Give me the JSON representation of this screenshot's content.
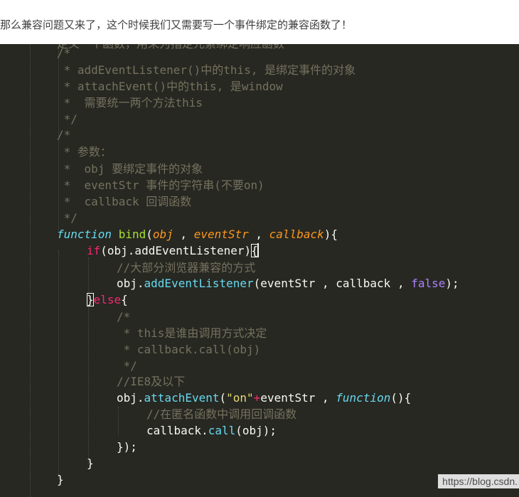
{
  "intro": {
    "text": "那么兼容问题又来了，这个时候我们又需要写一个事件绑定的兼容函数了！"
  },
  "code": {
    "cut_top": "定义一个函数，用来为指定元素绑定响应函数",
    "c1": {
      "open": "/*",
      "l1": " * addEventListener()中的this, 是绑定事件的对象",
      "l2": " * attachEvent()中的this, 是window",
      "l3": " *  需要统一两个方法this",
      "close": " */"
    },
    "c2": {
      "open": "/*",
      "l1": " * 参数：",
      "l2": " *  obj 要绑定事件的对象",
      "l3": " *  eventStr 事件的字符串(不要on)",
      "l4": " *  callback 回调函数",
      "close": " */"
    },
    "fn_keyword": "function",
    "fn_name": "bind",
    "p_open": "(",
    "p1": "obj",
    "sep": " , ",
    "p2": "eventStr",
    "p3": "callback",
    "p_close": "){",
    "if_kw": "if",
    "if_cond": "(obj.addEventListener)",
    "if_brace": "{",
    "cmt_most": "//大部分浏览器兼容的方式",
    "obj_dot": "obj.",
    "m_add": "addEventListener",
    "add_args": "(eventStr , callback , ",
    "false_kw": "false",
    "add_end": ");",
    "close_brace": "}",
    "else_kw": "else",
    "open_brace": "{",
    "c3": {
      "open": "/*",
      "l1": " * this是谁由调用方式决定",
      "l2": " * callback.call(obj)",
      "close": " */"
    },
    "cmt_ie8": "//IE8及以下",
    "m_attach": "attachEvent",
    "paren_open": "(",
    "str_on": "\"on\"",
    "plus": "+",
    "attach_mid": "eventStr , ",
    "fn_kw2": "function",
    "fn_tail": "(){",
    "cmt_anon": "//在匿名函数中调用回调函数",
    "cb_dot": "callback.",
    "m_call": "call",
    "call_args": "(obj);",
    "close_paren": "});",
    "inner_close": "}",
    "outer_close": "}"
  },
  "watermark": "https://blog.csdn."
}
